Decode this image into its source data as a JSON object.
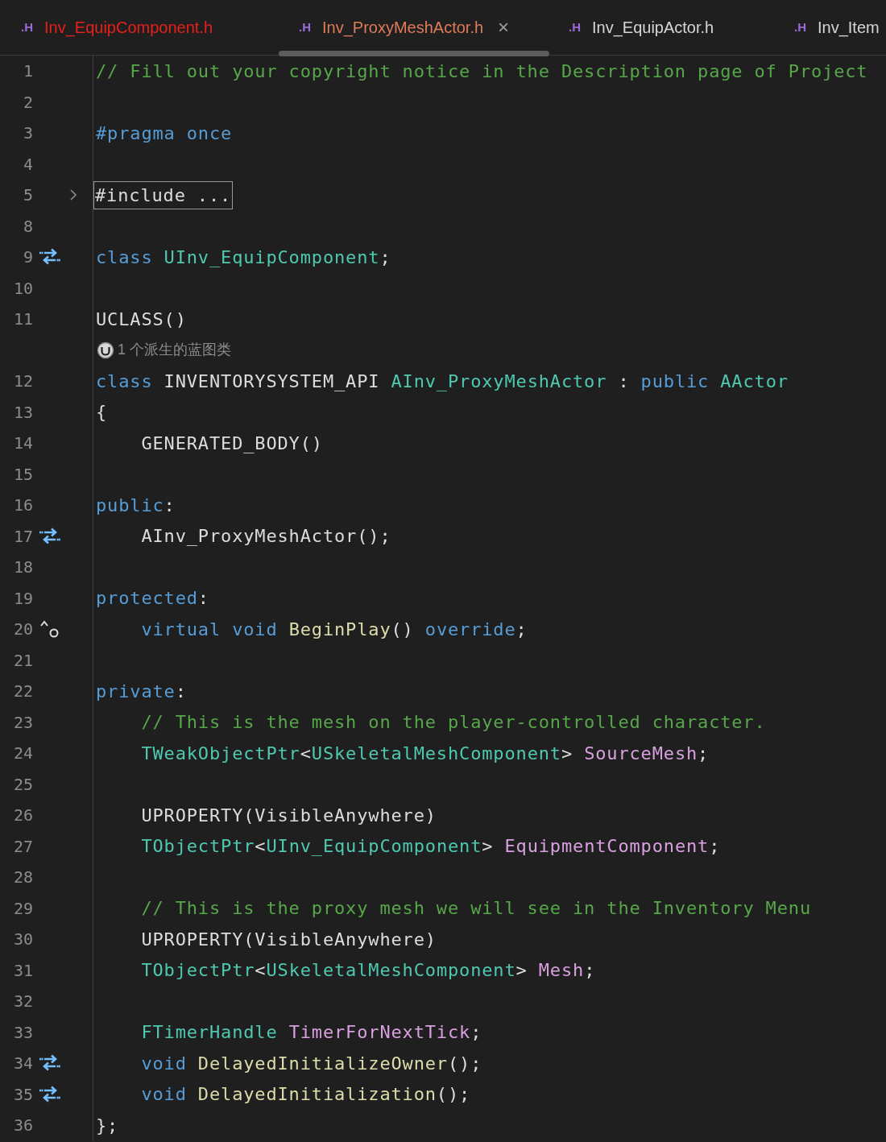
{
  "tabs": [
    {
      "icon": ".H",
      "label": "Inv_EquipComponent.h",
      "selected": false,
      "color": "#e8201c"
    },
    {
      "icon": ".H",
      "label": "Inv_ProxyMeshActor.h",
      "selected": true,
      "color": "#e07a5a",
      "close": "×"
    },
    {
      "icon": ".H",
      "label": "Inv_EquipActor.h",
      "selected": false,
      "color": "#d6d6d6"
    },
    {
      "icon": ".H",
      "label": "Inv_Item",
      "selected": false,
      "color": "#d6d6d6"
    }
  ],
  "lines": [
    {
      "kind": "code",
      "number": "1",
      "collapsed": false,
      "tokens": [
        {
          "kind": "comment",
          "text": "// Fill out your copyright notice in the Description page of Project"
        }
      ]
    },
    {
      "kind": "code",
      "number": "2",
      "collapsed": false
    },
    {
      "kind": "code",
      "number": "3",
      "collapsed": false,
      "tokens": [
        {
          "kind": "keyword",
          "text": "#pragma once"
        }
      ]
    },
    {
      "kind": "code",
      "number": "4",
      "collapsed": false
    },
    {
      "kind": "code",
      "number": "5",
      "collapsed": true,
      "tokens": [
        {
          "kind": "plain",
          "text": "#include ..."
        }
      ]
    },
    {
      "kind": "code",
      "number": "8",
      "collapsed": false
    },
    {
      "kind": "code",
      "number": "9",
      "collapsed": false,
      "gutter": {
        "kind": "swap"
      },
      "tokens": [
        {
          "kind": "keyword",
          "text": "class "
        },
        {
          "kind": "type",
          "text": "UInv_EquipComponent"
        },
        {
          "kind": "plain",
          "text": ";"
        }
      ]
    },
    {
      "kind": "code",
      "number": "10",
      "collapsed": false
    },
    {
      "kind": "code",
      "number": "11",
      "collapsed": false,
      "tokens": [
        {
          "kind": "plain",
          "text": "UCLASS()"
        }
      ]
    },
    {
      "kind": "hint",
      "text": "1 个派生的蓝图类"
    },
    {
      "kind": "code",
      "number": "12",
      "collapsed": false,
      "tokens": [
        {
          "kind": "keyword",
          "text": "class "
        },
        {
          "kind": "plain",
          "text": "INVENTORYSYSTEM_API "
        },
        {
          "kind": "type",
          "text": "AInv_ProxyMeshActor"
        },
        {
          "kind": "plain",
          "text": " : "
        },
        {
          "kind": "keyword",
          "text": "public "
        },
        {
          "kind": "type",
          "text": "AActor"
        }
      ]
    },
    {
      "kind": "code",
      "number": "13",
      "collapsed": false,
      "tokens": [
        {
          "kind": "plain",
          "text": "{"
        }
      ]
    },
    {
      "kind": "code",
      "number": "14",
      "collapsed": false,
      "tokens": [
        {
          "kind": "plain",
          "text": "    GENERATED_BODY()"
        }
      ]
    },
    {
      "kind": "code",
      "number": "15",
      "collapsed": false
    },
    {
      "kind": "code",
      "number": "16",
      "collapsed": false,
      "tokens": [
        {
          "kind": "keyword",
          "text": "public"
        },
        {
          "kind": "plain",
          "text": ":"
        }
      ]
    },
    {
      "kind": "code",
      "number": "17",
      "collapsed": false,
      "gutter": {
        "kind": "swap"
      },
      "tokens": [
        {
          "kind": "plain",
          "text": "    AInv_ProxyMeshActor();"
        }
      ]
    },
    {
      "kind": "code",
      "number": "18",
      "collapsed": false
    },
    {
      "kind": "code",
      "number": "19",
      "collapsed": false,
      "tokens": [
        {
          "kind": "keyword",
          "text": "protected"
        },
        {
          "kind": "plain",
          "text": ":"
        }
      ]
    },
    {
      "kind": "code",
      "number": "20",
      "collapsed": false,
      "gutter": {
        "kind": "override"
      },
      "tokens": [
        {
          "kind": "keyword",
          "text": "    virtual void "
        },
        {
          "kind": "function",
          "text": "BeginPlay"
        },
        {
          "kind": "plain",
          "text": "() "
        },
        {
          "kind": "keyword",
          "text": "override"
        },
        {
          "kind": "plain",
          "text": ";"
        }
      ]
    },
    {
      "kind": "code",
      "number": "21",
      "collapsed": false
    },
    {
      "kind": "code",
      "number": "22",
      "collapsed": false,
      "tokens": [
        {
          "kind": "keyword",
          "text": "private"
        },
        {
          "kind": "plain",
          "text": ":"
        }
      ]
    },
    {
      "kind": "code",
      "number": "23",
      "collapsed": false,
      "tokens": [
        {
          "kind": "comment",
          "text": "    // This is the mesh on the player-controlled character."
        }
      ]
    },
    {
      "kind": "code",
      "number": "24",
      "collapsed": false,
      "tokens": [
        {
          "kind": "type",
          "text": "    TWeakObjectPtr"
        },
        {
          "kind": "plain",
          "text": "<"
        },
        {
          "kind": "type",
          "text": "USkeletalMeshComponent"
        },
        {
          "kind": "plain",
          "text": "> "
        },
        {
          "kind": "member",
          "text": "SourceMesh"
        },
        {
          "kind": "plain",
          "text": ";"
        }
      ]
    },
    {
      "kind": "code",
      "number": "25",
      "collapsed": false
    },
    {
      "kind": "code",
      "number": "26",
      "collapsed": false,
      "tokens": [
        {
          "kind": "plain",
          "text": "    UPROPERTY(VisibleAnywhere)"
        }
      ]
    },
    {
      "kind": "code",
      "number": "27",
      "collapsed": false,
      "tokens": [
        {
          "kind": "type",
          "text": "    TObjectPtr"
        },
        {
          "kind": "plain",
          "text": "<"
        },
        {
          "kind": "type",
          "text": "UInv_EquipComponent"
        },
        {
          "kind": "plain",
          "text": "> "
        },
        {
          "kind": "member",
          "text": "EquipmentComponent"
        },
        {
          "kind": "plain",
          "text": ";"
        }
      ]
    },
    {
      "kind": "code",
      "number": "28",
      "collapsed": false
    },
    {
      "kind": "code",
      "number": "29",
      "collapsed": false,
      "tokens": [
        {
          "kind": "comment",
          "text": "    // This is the proxy mesh we will see in the Inventory Menu"
        }
      ]
    },
    {
      "kind": "code",
      "number": "30",
      "collapsed": false,
      "tokens": [
        {
          "kind": "plain",
          "text": "    UPROPERTY(VisibleAnywhere)"
        }
      ]
    },
    {
      "kind": "code",
      "number": "31",
      "collapsed": false,
      "tokens": [
        {
          "kind": "type",
          "text": "    TObjectPtr"
        },
        {
          "kind": "plain",
          "text": "<"
        },
        {
          "kind": "type",
          "text": "USkeletalMeshComponent"
        },
        {
          "kind": "plain",
          "text": "> "
        },
        {
          "kind": "member",
          "text": "Mesh"
        },
        {
          "kind": "plain",
          "text": ";"
        }
      ]
    },
    {
      "kind": "code",
      "number": "32",
      "collapsed": false
    },
    {
      "kind": "code",
      "number": "33",
      "collapsed": false,
      "tokens": [
        {
          "kind": "type",
          "text": "    FTimerHandle "
        },
        {
          "kind": "member",
          "text": "TimerForNextTick"
        },
        {
          "kind": "plain",
          "text": ";"
        }
      ]
    },
    {
      "kind": "code",
      "number": "34",
      "collapsed": false,
      "gutter": {
        "kind": "swap"
      },
      "tokens": [
        {
          "kind": "keyword",
          "text": "    void "
        },
        {
          "kind": "function",
          "text": "DelayedInitializeOwner"
        },
        {
          "kind": "plain",
          "text": "();"
        }
      ]
    },
    {
      "kind": "code",
      "number": "35",
      "collapsed": false,
      "gutter": {
        "kind": "swap"
      },
      "tokens": [
        {
          "kind": "keyword",
          "text": "    void "
        },
        {
          "kind": "function",
          "text": "DelayedInitialization"
        },
        {
          "kind": "plain",
          "text": "();"
        }
      ]
    },
    {
      "kind": "code",
      "number": "36",
      "collapsed": false,
      "tokens": [
        {
          "kind": "plain",
          "text": "};"
        }
      ]
    }
  ]
}
